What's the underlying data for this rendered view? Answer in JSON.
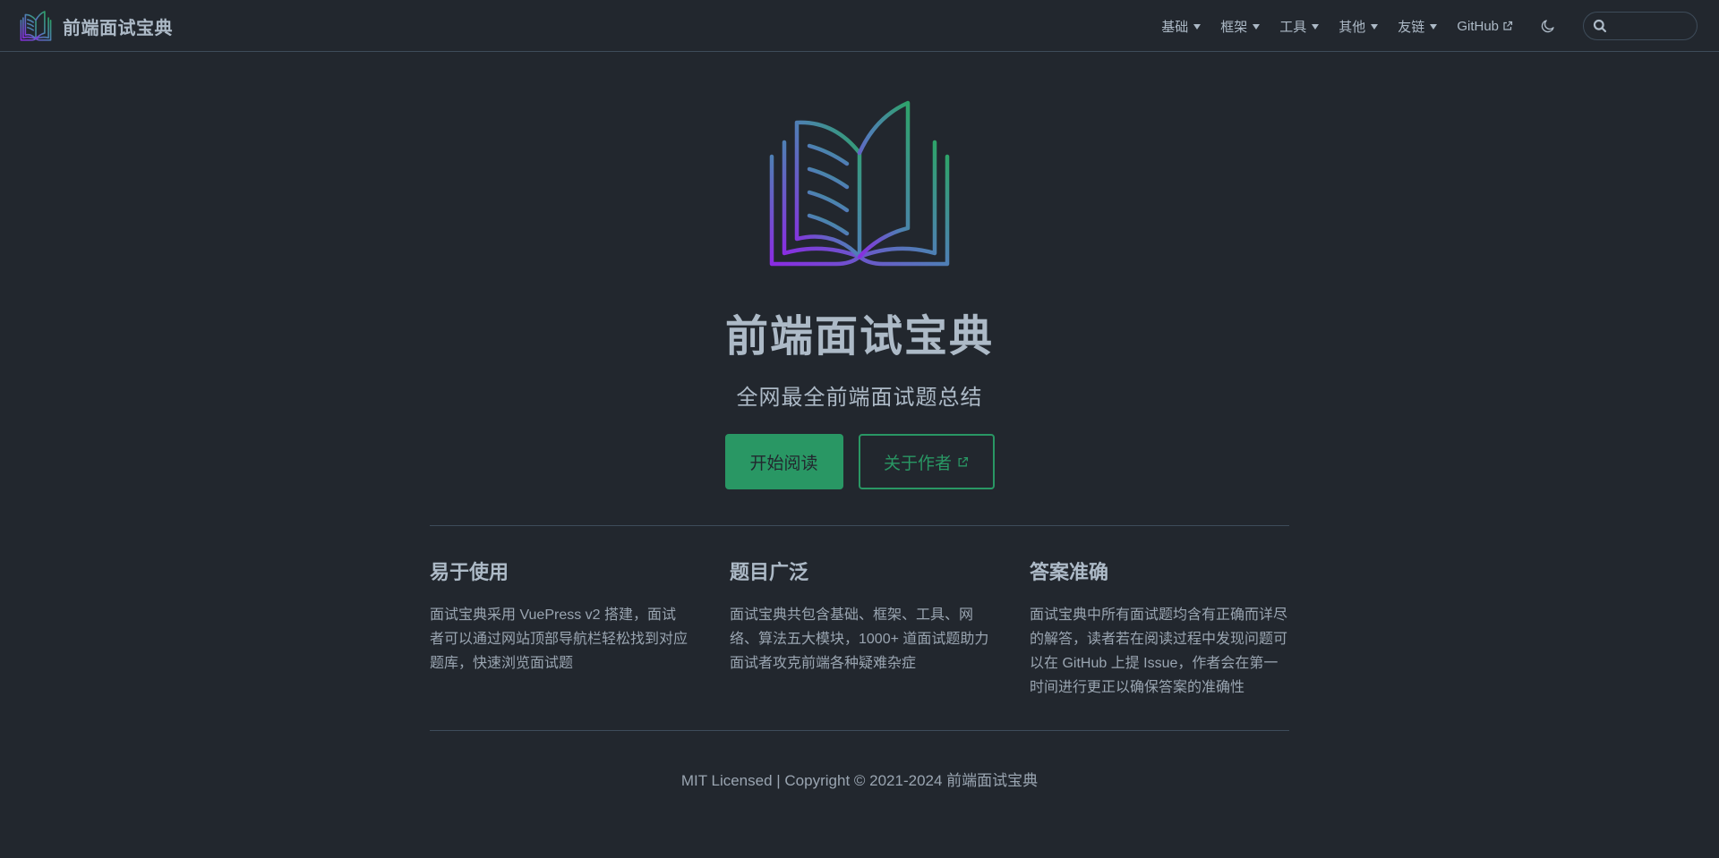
{
  "site": {
    "title": "前端面试宝典"
  },
  "nav": {
    "items": [
      {
        "label": "基础",
        "type": "dropdown"
      },
      {
        "label": "框架",
        "type": "dropdown"
      },
      {
        "label": "工具",
        "type": "dropdown"
      },
      {
        "label": "其他",
        "type": "dropdown"
      },
      {
        "label": "友链",
        "type": "dropdown"
      },
      {
        "label": "GitHub",
        "type": "external-link"
      }
    ],
    "theme_toggle_icon": "moon-icon",
    "search": {
      "value": "",
      "placeholder": "",
      "icon": "search-icon"
    }
  },
  "hero": {
    "logo_icon": "open-book-icon",
    "title": "前端面试宝典",
    "tagline": "全网最全前端面试题总结",
    "actions": [
      {
        "label": "开始阅读",
        "style": "primary"
      },
      {
        "label": "关于作者",
        "style": "secondary",
        "icon": "external-link-icon"
      }
    ]
  },
  "features": [
    {
      "title": "易于使用",
      "details": "面试宝典采用 VuePress v2 搭建，面试者可以通过网站顶部导航栏轻松找到对应题库，快速浏览面试题"
    },
    {
      "title": "题目广泛",
      "details": "面试宝典共包含基础、框架、工具、网络、算法五大模块，1000+ 道面试题助力面试者攻克前端各种疑难杂症"
    },
    {
      "title": "答案准确",
      "details": "面试宝典中所有面试题均含有正确而详尽的解答，读者若在阅读过程中发现问题可以在 GitHub 上提 Issue，作者会在第一时间进行更正以确保答案的准确性"
    }
  ],
  "footer": {
    "text": "MIT Licensed | Copyright © 2021-2024 前端面试宝典"
  },
  "colors": {
    "background": "#22272e",
    "text": "#adbac7",
    "brand": "#299764",
    "border": "#3e4c5a",
    "logo_gradient_start": "#8a2be2",
    "logo_gradient_end": "#2ea36a"
  }
}
